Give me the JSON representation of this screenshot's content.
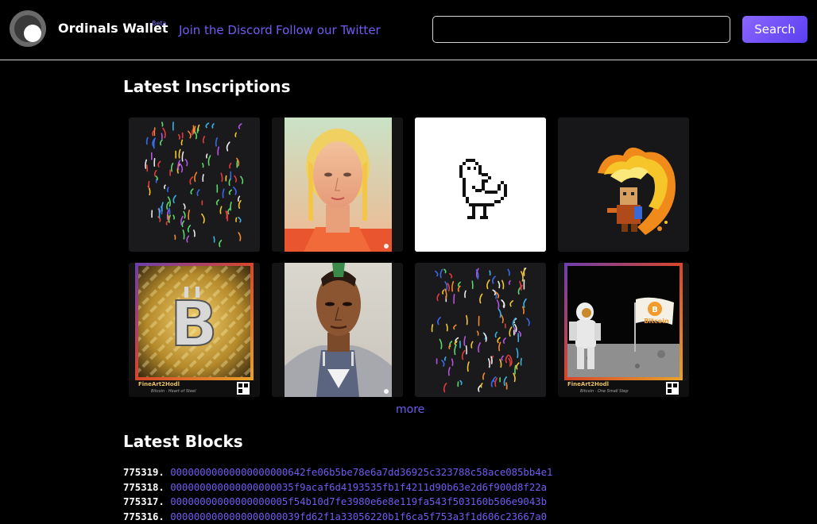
{
  "header": {
    "brand": "Ordinals Wallet",
    "beta": "Beta",
    "nav": [
      {
        "label": "Join the Discord"
      },
      {
        "label": "Follow our Twitter"
      }
    ],
    "search": {
      "value": "",
      "placeholder": "",
      "button_label": "Search"
    }
  },
  "inscriptions": {
    "title": "Latest Inscriptions",
    "items": [
      {
        "name": "colorful-squiggles-art"
      },
      {
        "name": "portrait-woman-art"
      },
      {
        "name": "pixel-duck-art"
      },
      {
        "name": "pixel-fire-character-art"
      },
      {
        "name": "gold-bitcoin-art",
        "caption": "FineArt2Hodl",
        "subcaption": "Bitcoin · Heart of Steel"
      },
      {
        "name": "portrait-man-art"
      },
      {
        "name": "colorful-squiggles-art"
      },
      {
        "name": "astronaut-bitcoin-flag-art",
        "caption": "FineArt2Hodl",
        "subcaption": "Bitcoin · One Small Step",
        "flag_text": "Bitcoin"
      }
    ],
    "more_label": "more"
  },
  "blocks": {
    "title": "Latest Blocks",
    "rows": [
      {
        "height": "775319.",
        "hash": "00000000000000000000642fe06b5be78e6a7dd36925c323788c58ace085bb4e1"
      },
      {
        "height": "775318.",
        "hash": "000000000000000000035f9acaf6d4193535fb1f4211d90b63e2d6f900d8f22a"
      },
      {
        "height": "775317.",
        "hash": "00000000000000000005f54b10d7fe3980e6e8e119fa543f503160b506e9043b"
      },
      {
        "height": "775316.",
        "hash": "0000000000000000000039fd62f1a33056220b1f6ca5f753a3f1d606c23667a0"
      }
    ]
  },
  "colors": {
    "background": "#000000",
    "accent": "#6f5cf2",
    "button": "#7b57fb"
  }
}
